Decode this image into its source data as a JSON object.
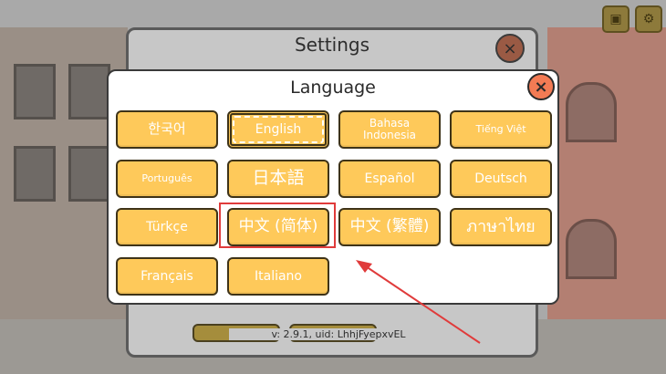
{
  "settings": {
    "title": "Settings",
    "close_label": "×",
    "version_text": "v: 2.9.1, uid: LhhjFyepxvEL"
  },
  "dialog": {
    "title": "Language",
    "close_label": "×"
  },
  "languages": [
    {
      "label": "한국어"
    },
    {
      "label": "English",
      "selected": true
    },
    {
      "label": "Bahasa Indonesia"
    },
    {
      "label": "Tiếng Việt"
    },
    {
      "label": "Português"
    },
    {
      "label": "日本語"
    },
    {
      "label": "Español"
    },
    {
      "label": "Deutsch"
    },
    {
      "label": "Türkçe"
    },
    {
      "label": "中文 (简体)",
      "highlighted": true
    },
    {
      "label": "中文 (繁體)"
    },
    {
      "label": "ภาษาไทย"
    },
    {
      "label": "Français"
    },
    {
      "label": "Italiano"
    }
  ],
  "colors": {
    "button_fill": "#fec95a",
    "button_border": "#3e3318",
    "close_button": "#f37b54",
    "highlight": "#e03b3b",
    "arrow": "#e03b3b"
  },
  "icons": {
    "top_left": "backpack-icon",
    "top_right": "gear-icon"
  }
}
